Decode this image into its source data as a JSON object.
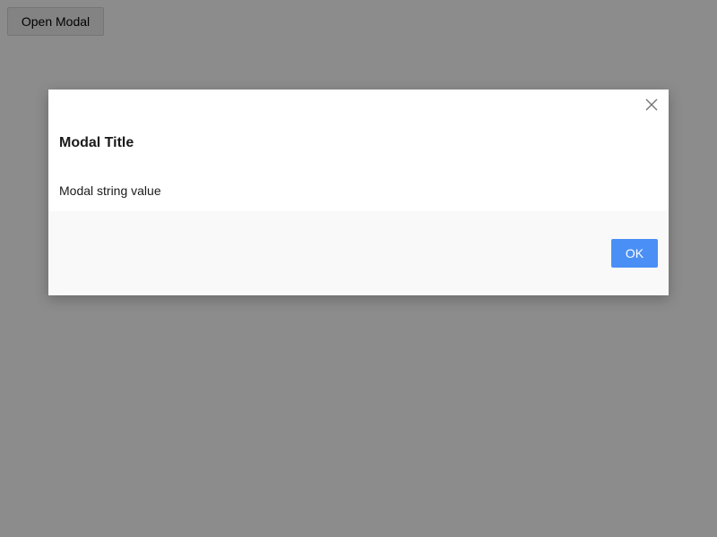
{
  "page": {
    "open_button_label": "Open Modal"
  },
  "modal": {
    "title": "Modal Title",
    "body_text": "Modal string value",
    "close_icon": "close-icon",
    "ok_label": "OK"
  },
  "colors": {
    "overlay": "#8a8a8a",
    "primary_button": "#4a8ff5",
    "footer_background": "#f9f9f9"
  }
}
